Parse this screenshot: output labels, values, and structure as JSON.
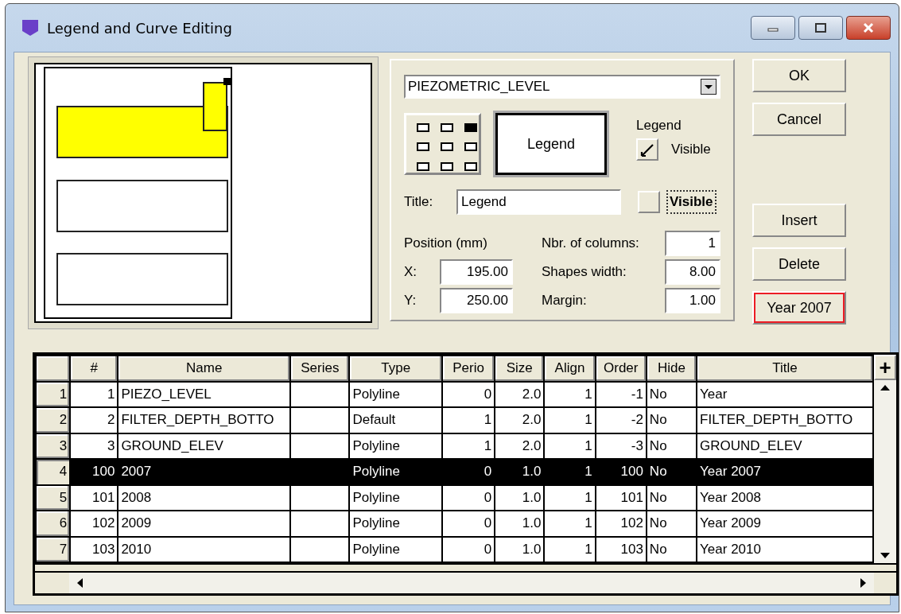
{
  "window": {
    "title": "Legend and Curve Editing"
  },
  "legend": {
    "curve": "PIEZOMETRIC_LEVEL",
    "anchor_grid": [
      {
        "selected": false
      },
      {
        "selected": false
      },
      {
        "selected": true
      },
      {
        "selected": false
      },
      {
        "selected": false
      },
      {
        "selected": false
      },
      {
        "selected": false
      },
      {
        "selected": false
      },
      {
        "selected": false
      }
    ],
    "preview_button": "Legend",
    "legend_label": "Legend",
    "legend_visible": {
      "label": "Visible",
      "checked": true
    },
    "title": {
      "label": "Title:",
      "value": "Legend"
    },
    "title_visible": {
      "label": "Visible",
      "checked": false
    },
    "position_label": "Position (mm)",
    "x": {
      "label": "X:",
      "value": "195.00"
    },
    "y": {
      "label": "Y:",
      "value": "250.00"
    },
    "columns": {
      "label": "Nbr. of columns:",
      "value": "1"
    },
    "shapes_width": {
      "label": "Shapes width:",
      "value": "8.00"
    },
    "margin": {
      "label": "Margin:",
      "value": "1.00"
    }
  },
  "buttons": [
    {
      "label": "OK",
      "kind": "plain"
    },
    {
      "label": "Cancel",
      "kind": "plain"
    },
    {
      "label": "Insert",
      "kind": "plain"
    },
    {
      "label": "Delete",
      "kind": "plain"
    },
    {
      "label": "Year 2007",
      "kind": "style"
    }
  ],
  "table": {
    "columns": [
      "#",
      "Name",
      "Series",
      "Type",
      "Perio",
      "Size",
      "Align",
      "Order",
      "Hide",
      "Title"
    ],
    "corner_button": "+",
    "rows": [
      {
        "header": "1",
        "selected": false,
        "cells": [
          "1",
          "PIEZO_LEVEL",
          null,
          "Polyline",
          "0",
          "2.0",
          "1",
          "-1",
          "No",
          "Year"
        ]
      },
      {
        "header": "2",
        "selected": false,
        "cells": [
          "2",
          "FILTER_DEPTH_BOTTO",
          null,
          "Default",
          "1",
          "2.0",
          "1",
          "-2",
          "No",
          "FILTER_DEPTH_BOTTO"
        ]
      },
      {
        "header": "3",
        "selected": false,
        "cells": [
          "3",
          "GROUND_ELEV",
          null,
          "Polyline",
          "1",
          "2.0",
          "1",
          "-3",
          "No",
          "GROUND_ELEV"
        ]
      },
      {
        "header": "4",
        "selected": true,
        "cells": [
          "100",
          "2007",
          null,
          "Polyline",
          "0",
          "1.0",
          "1",
          "100",
          "No",
          "Year 2007"
        ]
      },
      {
        "header": "5",
        "selected": false,
        "cells": [
          "101",
          "2008",
          null,
          "Polyline",
          "0",
          "1.0",
          "1",
          "101",
          "No",
          "Year 2008"
        ]
      },
      {
        "header": "6",
        "selected": false,
        "cells": [
          "102",
          "2009",
          null,
          "Polyline",
          "0",
          "1.0",
          "1",
          "102",
          "No",
          "Year 2009"
        ]
      },
      {
        "header": "7",
        "selected": false,
        "cells": [
          "103",
          "2010",
          null,
          "Polyline",
          "0",
          "1.0",
          "1",
          "103",
          "No",
          "Year 2010"
        ]
      }
    ]
  }
}
